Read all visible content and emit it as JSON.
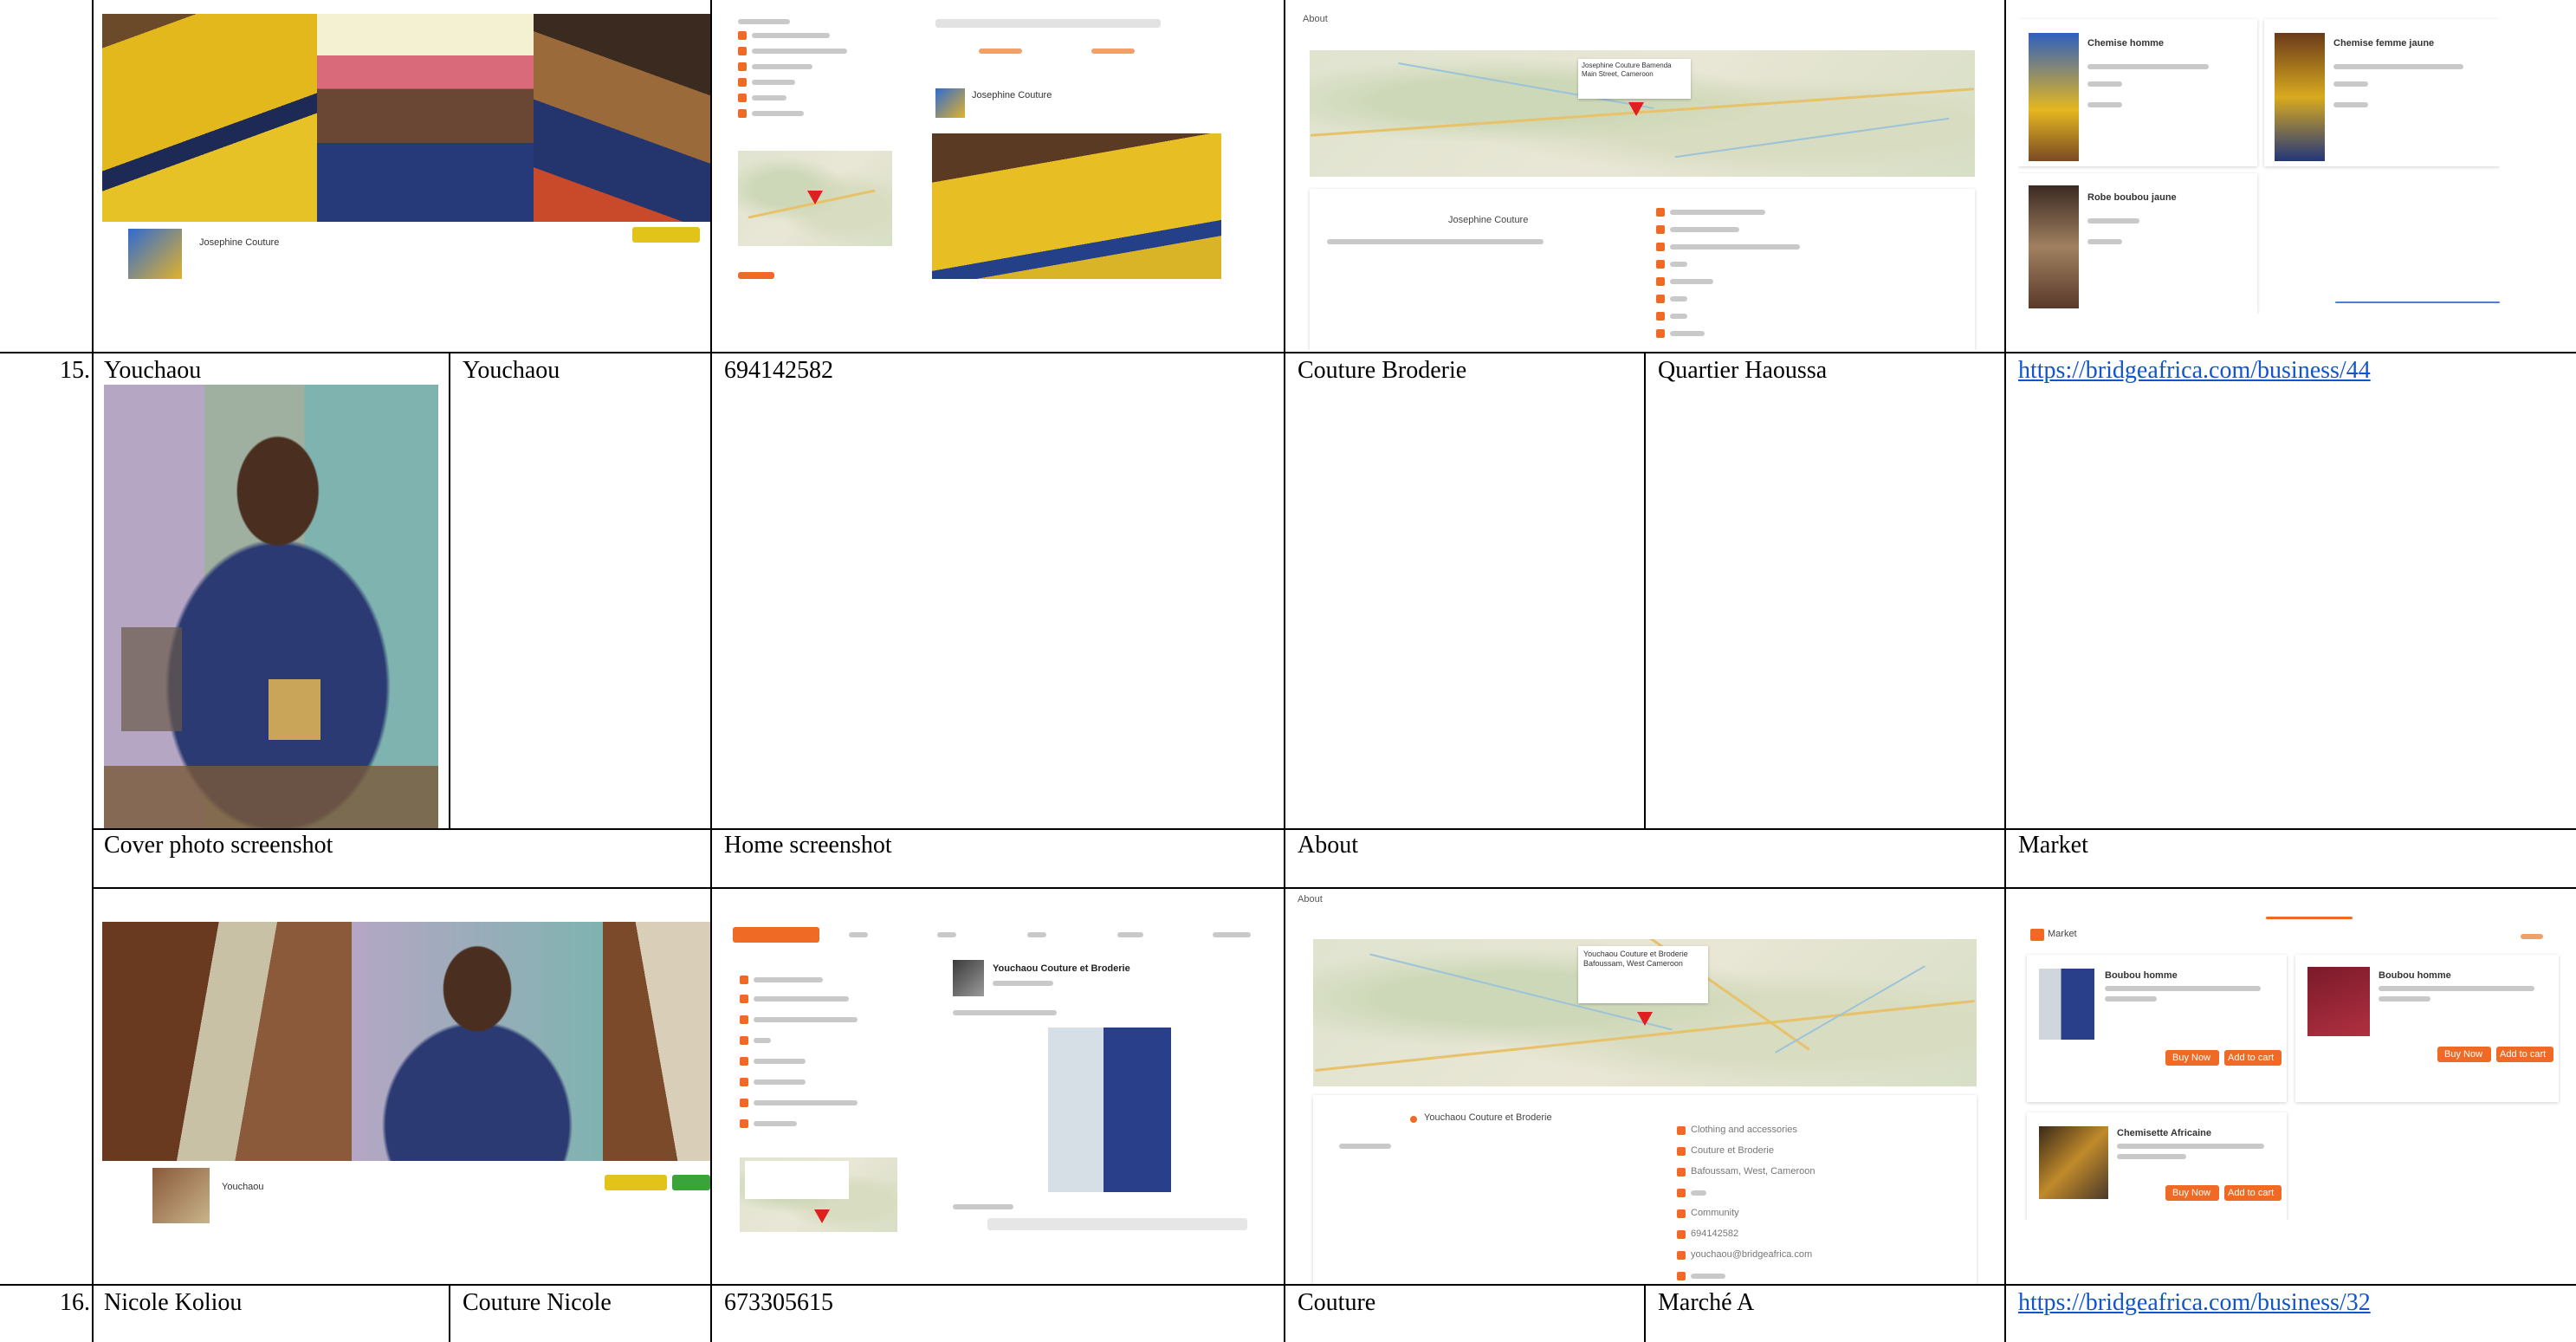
{
  "rows": [
    {
      "number": "15.",
      "name": "Youchaou",
      "business_name": "Youchaou",
      "phone": "694142582",
      "category": "Couture Broderie",
      "location": "Quartier Haoussa",
      "url": "https://bridgeafrica.com/business/44"
    },
    {
      "number": "16.",
      "name": "Nicole Koliou",
      "business_name": "Couture Nicole",
      "phone": "673305615",
      "category": "Couture",
      "location": "Marché A",
      "url": "https://bridgeafrica.com/business/32"
    }
  ],
  "section_headers": {
    "cover": "Cover photo screenshot",
    "home": "Home screenshot",
    "about": "About",
    "market": "Market"
  },
  "top_screens": {
    "cover_name": "Josephine Couture",
    "home_post_author": "Josephine Couture",
    "about_map_label": "Josephine Couture Bamenda Main Street, Cameroon",
    "about_business": "Josephine Couture",
    "market_items": [
      "Chemise homme",
      "Chemise femme jaune",
      "Robe boubou jaune"
    ]
  },
  "youchaou_screens": {
    "cover_name": "Youchaou",
    "home_post_author": "Youchaou Couture et Broderie",
    "about_title": "About",
    "about_map_label": "Youchaou Couture et Broderie Bafoussam, West Cameroon",
    "about_business": "Youchaou Couture et Broderie",
    "about_details": [
      "Clothing and accessories",
      "Couture et Broderie",
      "Bafoussam, West, Cameroon",
      "Community",
      "694142582",
      "youchaou@bridgeafrica.com"
    ],
    "market_title": "Market",
    "market_items": [
      "Boubou homme",
      "Boubou homme",
      "Chemisette Africaine"
    ],
    "market_buttons": [
      "Buy Now",
      "Add to cart"
    ]
  },
  "colors": {
    "accent_orange": "#ef6a24",
    "link_blue": "#1155cc",
    "map_pin": "#e02020"
  }
}
